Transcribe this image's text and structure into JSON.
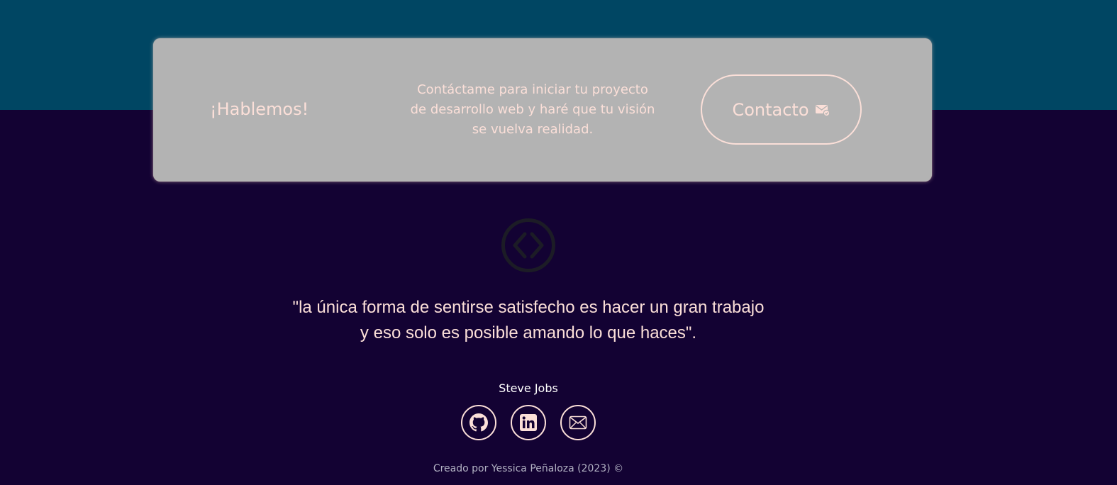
{
  "cta": {
    "heading": "¡Hablemos!",
    "text": "Contáctame para iniciar tu proyecto de desarrollo web y haré que tu visión se vuelva realidad.",
    "button_label": "Contacto"
  },
  "quote": {
    "line1": "\"la única forma de sentirse satisfecho es hacer un gran trabajo",
    "line2": "y eso solo es posible amando lo que haces\".",
    "author": "Steve Jobs"
  },
  "social": {
    "icons": [
      "github-icon",
      "linkedin-icon",
      "mail-icon"
    ]
  },
  "footer": {
    "credit": "Creado por Yessica Peñaloza (2023) ©"
  },
  "colors": {
    "top_band": "#004663",
    "background": "#130233",
    "card": "#b3b3b3",
    "accent": "#fbdfd8"
  }
}
